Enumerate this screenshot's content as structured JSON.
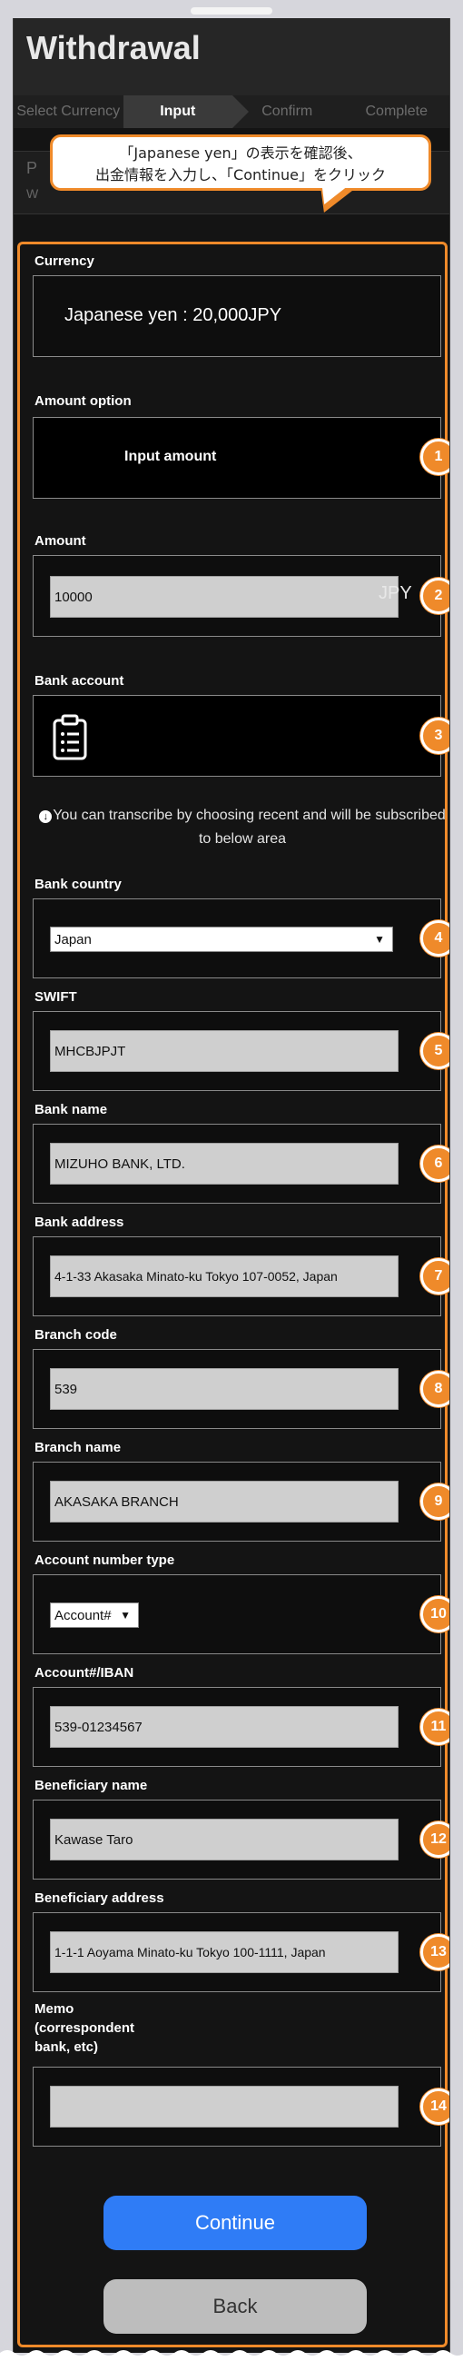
{
  "header": {
    "title": "Withdrawal"
  },
  "steps": [
    "Select Currency",
    "Input",
    "Confirm",
    "Complete"
  ],
  "hidden_row": {
    "line1": "P",
    "line2": "W"
  },
  "callout": {
    "line1": "「Japanese yen」の表示を確認後、",
    "line2": "出金情報を入力し、「Continue」をクリック"
  },
  "form": {
    "currency": {
      "label": "Currency",
      "value": "Japanese yen : 20,000JPY"
    },
    "amount_option": {
      "label": "Amount option",
      "value": "Input amount",
      "badge": "1"
    },
    "amount": {
      "label": "Amount",
      "value": "10000",
      "unit": "JPY",
      "badge": "2"
    },
    "bank_account": {
      "label": "Bank account",
      "badge": "3"
    },
    "info_text": {
      "line1": "You can transcribe by choosing recent and will be subscribed",
      "line2": "to below area"
    },
    "bank_country": {
      "label": "Bank country",
      "value": "Japan",
      "badge": "4"
    },
    "swift": {
      "label": "SWIFT",
      "value": "MHCBJPJT",
      "badge": "5"
    },
    "bank_name": {
      "label": "Bank name",
      "value": "MIZUHO BANK, LTD.",
      "badge": "6"
    },
    "bank_address": {
      "label": "Bank address",
      "value": "4-1-33 Akasaka Minato-ku Tokyo 107-0052, Japan",
      "badge": "7"
    },
    "branch_code": {
      "label": "Branch code",
      "value": "539",
      "badge": "8"
    },
    "branch_name": {
      "label": "Branch name",
      "value": "AKASAKA BRANCH",
      "badge": "9"
    },
    "account_number_type": {
      "label": "Account number type",
      "value": "Account#",
      "badge": "10"
    },
    "account_iban": {
      "label": "Account#/IBAN",
      "value": "539-01234567",
      "badge": "11"
    },
    "beneficiary_name": {
      "label": "Beneficiary name",
      "value": "Kawase Taro",
      "badge": "12"
    },
    "beneficiary_address": {
      "label": "Beneficiary address",
      "value": "1-1-1 Aoyama Minato-ku Tokyo 100-1111, Japan",
      "badge": "13"
    },
    "memo": {
      "label_line1": "Memo",
      "label_line2": "(correspondent",
      "label_line3": "bank, etc)",
      "value": "",
      "badge": "14"
    }
  },
  "buttons": {
    "continue": "Continue",
    "back": "Back"
  },
  "colors": {
    "accent": "#ef8a2a",
    "primary": "#2f7cf6",
    "background": "#141414"
  },
  "icons": [
    "clipboard-icon",
    "down-arrow-circle-icon",
    "chevron-down-icon"
  ]
}
